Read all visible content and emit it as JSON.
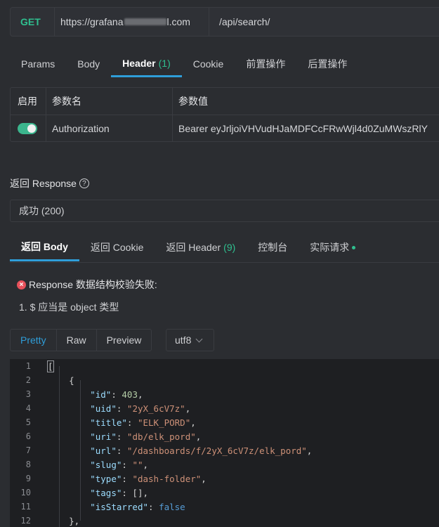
{
  "request": {
    "method": "GET",
    "host_prefix": "https://grafana",
    "host_suffix": "l.com",
    "path": "/api/search/"
  },
  "request_tabs": [
    {
      "label": "Params"
    },
    {
      "label": "Body"
    },
    {
      "label": "Header",
      "count": "(1)"
    },
    {
      "label": "Cookie"
    },
    {
      "label": "前置操作"
    },
    {
      "label": "后置操作"
    }
  ],
  "header_table": {
    "columns": [
      "启用",
      "参数名",
      "参数值"
    ],
    "rows": [
      {
        "enabled": true,
        "name": "Authorization",
        "value": "Bearer eyJrljoiVHVudHJaMDFCcFRwWjl4d0ZuMWszRlY"
      }
    ]
  },
  "response": {
    "title": "返回 Response",
    "help_icon": "question-circle-icon",
    "status": "成功 (200)"
  },
  "response_tabs": [
    {
      "label": "返回 Body"
    },
    {
      "label": "返回 Cookie"
    },
    {
      "label": "返回 Header",
      "count": "(9)"
    },
    {
      "label": "控制台"
    },
    {
      "label": "实际请求"
    }
  ],
  "validation": {
    "error": "Response 数据结构校验失败:",
    "items": [
      "1. $ 应当是 object 类型"
    ]
  },
  "format_buttons": [
    "Pretty",
    "Raw",
    "Preview"
  ],
  "encoding": "utf8",
  "code": {
    "line_numbers": [
      "1",
      "2",
      "3",
      "4",
      "5",
      "6",
      "7",
      "8",
      "9",
      "10",
      "11",
      "12"
    ],
    "lines": [
      "[",
      "    {",
      "        \"id\": 403,",
      "        \"uid\": \"2yX_6cV7z\",",
      "        \"title\": \"ELK_PORD\",",
      "        \"uri\": \"db/elk_pord\",",
      "        \"url\": \"/dashboards/f/2yX_6cV7z/elk_pord\",",
      "        \"slug\": \"\",",
      "        \"type\": \"dash-folder\",",
      "        \"tags\": [],",
      "        \"isStarred\": false",
      "    },"
    ]
  },
  "colors": {
    "accent": "#2f9ed9",
    "method_get": "#2fbf8f",
    "error": "#e8515b"
  }
}
